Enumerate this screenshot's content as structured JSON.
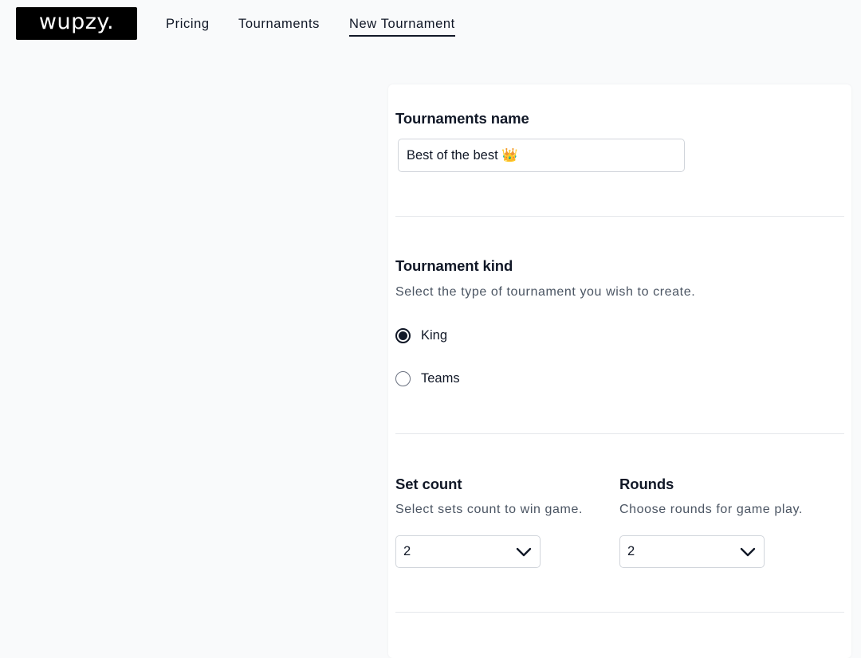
{
  "nav": {
    "logo": "wupzy.",
    "links": [
      {
        "label": "Pricing"
      },
      {
        "label": "Tournaments"
      },
      {
        "label": "New Tournament",
        "active": true
      }
    ]
  },
  "form": {
    "name_section": {
      "title": "Tournaments name",
      "input_value": "Best of the best 👑"
    },
    "kind_section": {
      "title": "Tournament kind",
      "description": "Select the type of tournament you wish to create.",
      "options": [
        {
          "label": "King",
          "checked": true
        },
        {
          "label": "Teams",
          "checked": false
        }
      ]
    },
    "set_count": {
      "title": "Set count",
      "description": "Select sets count to win game.",
      "value": "2"
    },
    "rounds": {
      "title": "Rounds",
      "description": "Choose rounds for game play.",
      "value": "2"
    }
  }
}
